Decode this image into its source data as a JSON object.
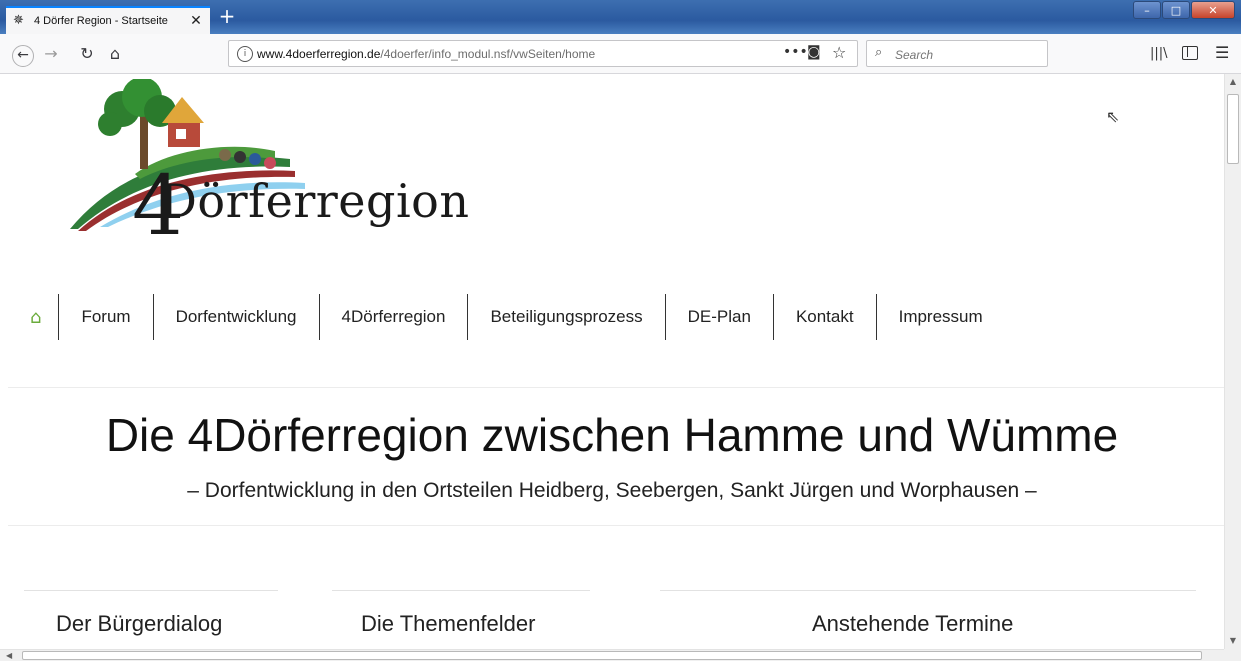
{
  "browser": {
    "tab_title": "4 Dörfer Region - Startseite",
    "url_domain": "www.4doerferregion.de",
    "url_path": "/4doerfer/info_modul.nsf/vwSeiten/home",
    "search_placeholder": "Search"
  },
  "logo": {
    "number": "4",
    "text": "Dörferregion"
  },
  "nav": {
    "home_icon": "home-icon",
    "items": [
      "Forum",
      "Dorfentwicklung",
      "4Dörferregion",
      "Beteiligungsprozess",
      "DE-Plan",
      "Kontakt",
      "Impressum"
    ],
    "accent_color": "#6aab3b"
  },
  "hero": {
    "headline": "Die 4Dörferregion zwischen Hamme und Wümme",
    "subline": "– Dorfentwicklung in den Ortsteilen Heidberg, Seebergen, Sankt Jürgen und Worphausen –"
  },
  "columns": [
    {
      "title": "Der Bürgerdialog"
    },
    {
      "title": "Die Themenfelder"
    },
    {
      "title": "Anstehende Termine"
    }
  ]
}
